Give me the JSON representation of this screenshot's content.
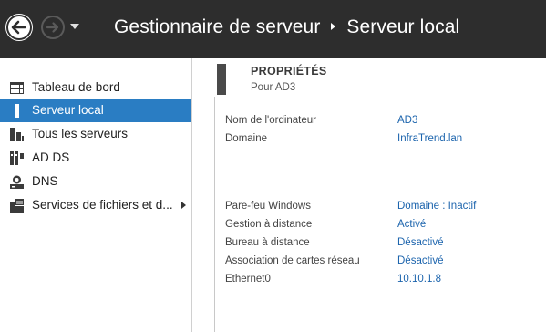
{
  "titlebar": {
    "app_name": "Gestionnaire de serveur",
    "page_name": "Serveur local"
  },
  "sidebar": {
    "items": [
      {
        "label": "Tableau de bord",
        "icon": "dashboard-grid-icon"
      },
      {
        "label": "Serveur local",
        "icon": "local-server-icon",
        "active": true
      },
      {
        "label": "Tous les serveurs",
        "icon": "all-servers-icon"
      },
      {
        "label": "AD DS",
        "icon": "ad-ds-icon"
      },
      {
        "label": "DNS",
        "icon": "dns-icon"
      },
      {
        "label": "Services de fichiers et d...",
        "icon": "file-services-icon",
        "has_submenu": true
      }
    ]
  },
  "properties": {
    "title": "PROPRIÉTÉS",
    "subtitle": "Pour AD3",
    "rows": [
      {
        "key": "Nom de l'ordinateur",
        "value": "AD3"
      },
      {
        "key": "Domaine",
        "value": "InfraTrend.lan"
      },
      {
        "key": "Pare-feu Windows",
        "value": "Domaine : Inactif"
      },
      {
        "key": "Gestion à distance",
        "value": "Activé"
      },
      {
        "key": "Bureau à distance",
        "value": "Désactivé"
      },
      {
        "key": "Association de cartes réseau",
        "value": "Désactivé"
      },
      {
        "key": "Ethernet0",
        "value": "10.10.1.8"
      }
    ]
  },
  "colors": {
    "titlebar_bg": "#2d2d2d",
    "active_item_bg": "#2a7dc3",
    "link_value": "#1c64ad"
  }
}
